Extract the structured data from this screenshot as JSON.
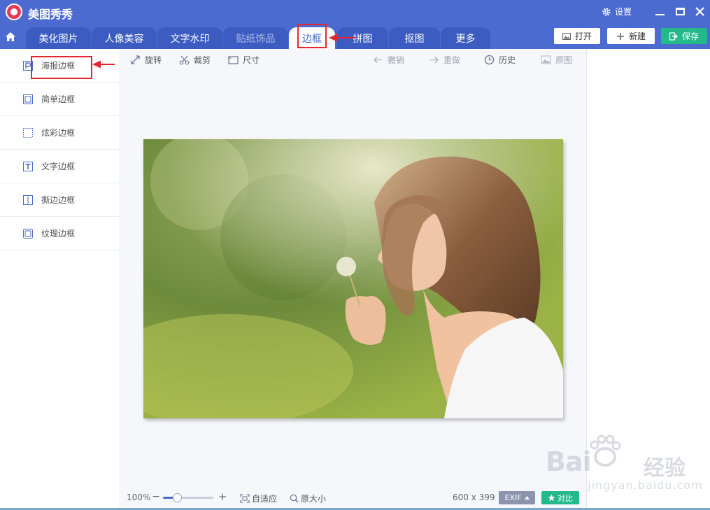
{
  "app": {
    "title": "美图秀秀",
    "settings_label": "设置"
  },
  "tabs": [
    {
      "label": "美化图片",
      "state": "normal"
    },
    {
      "label": "人像美容",
      "state": "normal"
    },
    {
      "label": "文字水印",
      "state": "normal"
    },
    {
      "label": "贴纸饰品",
      "state": "disabled"
    },
    {
      "label": "边框",
      "state": "active"
    },
    {
      "label": "拼图",
      "state": "normal"
    },
    {
      "label": "抠图",
      "state": "normal"
    },
    {
      "label": "更多",
      "state": "normal"
    }
  ],
  "actions": {
    "open": "打开",
    "new": "新建",
    "save": "保存"
  },
  "sidebar": {
    "items": [
      {
        "label": "海报边框",
        "icon": "poster-frame-icon"
      },
      {
        "label": "简单边框",
        "icon": "simple-frame-icon"
      },
      {
        "label": "炫彩边框",
        "icon": "colorful-frame-icon"
      },
      {
        "label": "文字边框",
        "icon": "text-frame-icon"
      },
      {
        "label": "撕边边框",
        "icon": "torn-edge-frame-icon"
      },
      {
        "label": "纹理边框",
        "icon": "texture-frame-icon"
      }
    ]
  },
  "toolbar": {
    "rotate": "旋转",
    "crop": "裁剪",
    "size": "尺寸",
    "undo": "撤销",
    "redo": "重做",
    "history": "历史",
    "original": "原图"
  },
  "status": {
    "zoom": "100%",
    "zoom_level": 0.28,
    "fit": "自适应",
    "actual": "原大小",
    "dimensions": "600 x 399",
    "exif": "EXIF",
    "compare": "对比"
  },
  "watermark": {
    "brand": "Bai",
    "text": "经验",
    "url": "jingyan.baidu.com"
  },
  "colors": {
    "brand": "#4b6bd0",
    "save": "#23b98a",
    "annotation": "#e6262e"
  }
}
